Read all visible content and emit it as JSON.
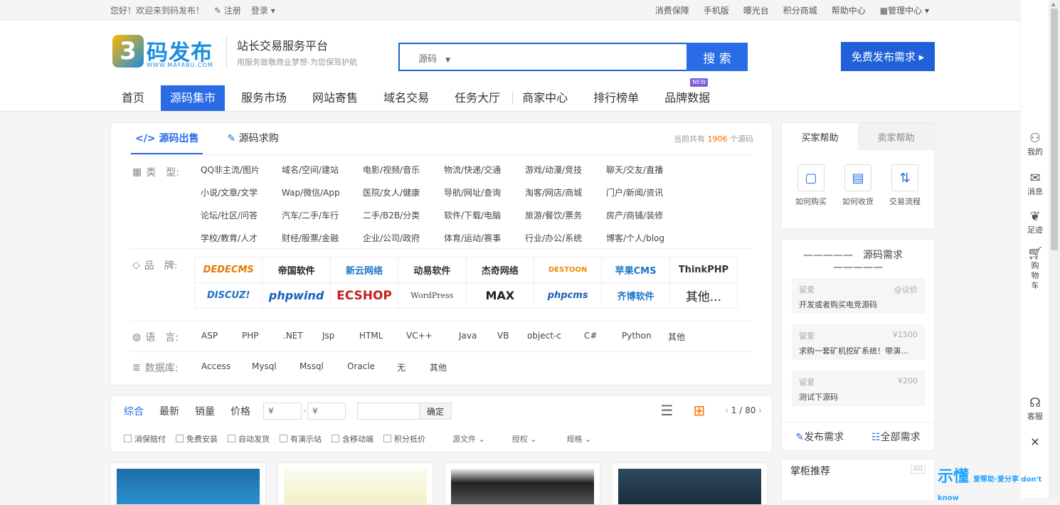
{
  "topbar": {
    "welcome": "您好！欢迎来到码发布！",
    "register": "注册",
    "login": "登录",
    "links": [
      "消费保障",
      "手机版",
      "曝光台",
      "积分商城",
      "帮助中心"
    ],
    "manage": "管理中心"
  },
  "header": {
    "logo_brand": "码发布",
    "logo_url": "WWW.MAFABU.COM",
    "slogan_title": "站长交易服务平台",
    "slogan_sub": "用服务致敬商业梦想-为您保驾护航",
    "search_category": "源码",
    "search_button": "搜 索",
    "publish_button": "免费发布需求 ▸"
  },
  "nav": {
    "items": [
      "首页",
      "源码集市",
      "服务市场",
      "网站寄售",
      "域名交易",
      "任务大厅",
      "商家中心",
      "排行榜单",
      "品牌数据"
    ],
    "badge": "NEW"
  },
  "filter": {
    "tab_sale": "源码出售",
    "tab_buy": "源码求购",
    "count_prefix": "当前共有 ",
    "count": "1906",
    "count_suffix": " 个源码",
    "type_label": "类　型:",
    "types": [
      "QQ非主流/图片",
      "域名/空间/建站",
      "电影/视频/音乐",
      "物流/快递/交通",
      "游戏/动漫/竞技",
      "聊天/交友/直播",
      "小说/文章/文学",
      "Wap/微信/App",
      "医院/女人/健康",
      "导航/网址/查询",
      "淘客/网店/商城",
      "门户/新闻/资讯",
      "论坛/社区/问答",
      "汽车/二手/车行",
      "二手/B2B/分类",
      "软件/下载/电脑",
      "旅游/餐饮/票务",
      "房产/商铺/装修",
      "学校/教育/人才",
      "财经/股票/金融",
      "企业/公司/政府",
      "体育/运动/赛事",
      "行业/办公/系统",
      "博客/个人/blog"
    ],
    "brand_label": "品　牌:",
    "brands": [
      "DEDECMS",
      "帝国软件",
      "新云网络",
      "动易软件",
      "杰奇网络",
      "DESTOON",
      "苹果CMS",
      "ThinkPHP",
      "DISCUZ!",
      "phpwind",
      "ECSHOP",
      "WordPress",
      "MAX",
      "phpcms",
      "齐博软件",
      "其他..."
    ],
    "lang_label": "语　言:",
    "langs": [
      "ASP",
      "PHP",
      ".NET",
      "Jsp",
      "HTML",
      "VC++",
      "Java",
      "VB",
      "object-c",
      "C#",
      "Python",
      "其他"
    ],
    "db_label": "数据库:",
    "dbs": [
      "Access",
      "Mysql",
      "Mssql",
      "Oracle",
      "无",
      "其他"
    ]
  },
  "sortbar": {
    "sorts": [
      "综合",
      "最新",
      "销量",
      "价格"
    ],
    "price_from": "¥",
    "price_to": "¥",
    "ok": "确定",
    "page": "1 / 80",
    "options": [
      "消保赔付",
      "免费安装",
      "自动发货",
      "有演示站",
      "含移动端",
      "积分抵价"
    ],
    "dropdowns": [
      "源文件",
      "授权",
      "规格"
    ]
  },
  "help": {
    "tab_buyer": "买家帮助",
    "tab_seller": "卖家帮助",
    "items": [
      "如何购买",
      "如何收货",
      "交易流程"
    ]
  },
  "demand": {
    "title": "源码需求",
    "items": [
      {
        "user": "留爱",
        "price": "@议价",
        "text": "开发或者购买电竞源码"
      },
      {
        "user": "留爱",
        "price": "¥1500",
        "text": "求购一套矿机挖矿系统！带演..."
      },
      {
        "user": "留爱",
        "price": "¥200",
        "text": "测试下源码"
      }
    ],
    "publish": "发布需求",
    "all": "全部需求"
  },
  "recommend": {
    "title": "掌柜推荐",
    "ad": "AD"
  },
  "rail": {
    "items": [
      "我的",
      "消息",
      "足迹",
      "购物车",
      "客服"
    ]
  },
  "watermark": {
    "main": "示懂",
    "sub": "爱帮助·爱分享 don't know"
  },
  "colors": {
    "primary": "#2a6be6",
    "accent": "#ff6a00"
  }
}
